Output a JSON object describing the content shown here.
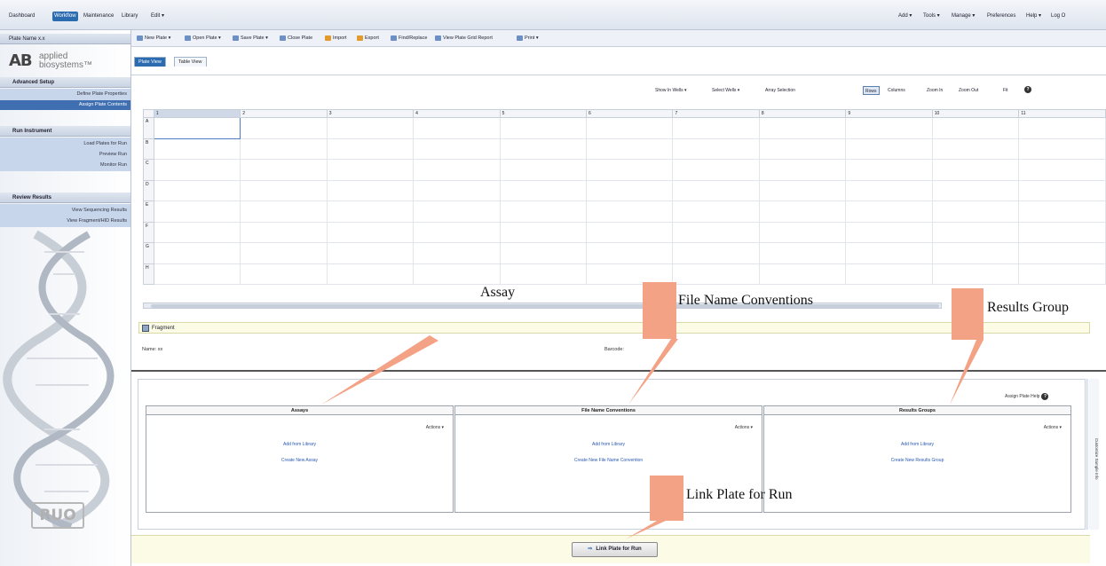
{
  "topnav": {
    "tabs": [
      "Dashboard",
      "Workflow",
      "Maintenance",
      "Library",
      "Edit ▾"
    ],
    "right": [
      "Add ▾",
      "Tools ▾",
      "Manage ▾",
      "Preferences",
      "Help ▾",
      "Log O"
    ],
    "active_color": "#2b6cb0"
  },
  "sidebar": {
    "plate_name": "Plate Name x.x",
    "logo": {
      "mark": "AB",
      "line1": "applied",
      "line2": "biosystems™"
    },
    "sections": [
      {
        "title": "Advanced Setup",
        "icon": "gear-icon",
        "items": [
          "Define Plate Properties",
          "Assign Plate Contents"
        ],
        "selected": 1
      },
      {
        "title": "Run Instrument",
        "icon": "instrument-icon",
        "items": [
          "Load Plates for Run",
          "Preview Run",
          "Monitor Run"
        ],
        "selected": -1
      },
      {
        "title": "Review Results",
        "icon": "chart-icon",
        "items": [
          "View Sequencing Results",
          "View Fragment/HID Results"
        ],
        "selected": -1
      }
    ],
    "ruo": "RUO"
  },
  "toolbar": {
    "items": [
      "New Plate ▾",
      "Open Plate ▾",
      "Save Plate ▾",
      "Close Plate",
      "Import",
      "Export",
      "Find/Replace",
      "View Plate Grid Report",
      "Print ▾"
    ]
  },
  "view_tabs": {
    "plate": "Plate View",
    "table": "Table View"
  },
  "grid_tools": {
    "show_in_wells": "Show In Wells ▾",
    "select_wells": "Select Wells ▾",
    "array_selection": "Array Selection",
    "rows": "Rows",
    "columns": "Columns",
    "zoom_in": "Zoom In",
    "zoom_out": "Zoom Out",
    "fit": "Fit",
    "help": "?"
  },
  "plate": {
    "columns": [
      "1",
      "2",
      "3",
      "4",
      "5",
      "6",
      "7",
      "8",
      "9",
      "10",
      "11"
    ],
    "rows": [
      "A",
      "B",
      "C",
      "D",
      "E",
      "F",
      "G",
      "H"
    ]
  },
  "fragment": {
    "title": "Fragment",
    "name_label": "Name: xx",
    "barcode_label": "Barcode:"
  },
  "assign": {
    "help_text": "Assign Plate Help",
    "columns": [
      {
        "title": "Assays",
        "actions": "Actions ▾",
        "link1": "Add from Library",
        "link2": "Create New Assay"
      },
      {
        "title": "File Name Conventions",
        "actions": "Actions ▾",
        "link1": "Add from Library",
        "link2": "Create New File Name Convention"
      },
      {
        "title": "Results Groups",
        "actions": "Actions ▾",
        "link1": "Add from Library",
        "link2": "Create New Results Group"
      }
    ],
    "rail_text": "Customize Sample Info"
  },
  "link_button": "Link Plate for Run",
  "callouts": {
    "assay": "Assay",
    "file_name": "File Name Conventions",
    "results_group": "Results Group",
    "link_plate": "Link Plate for Run",
    "color": "#f4a285"
  }
}
